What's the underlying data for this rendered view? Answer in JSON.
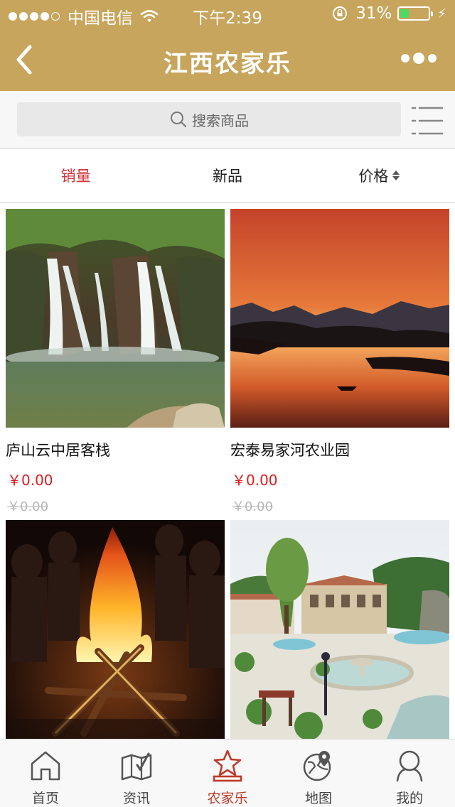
{
  "status_bar": {
    "carrier": "中国电信",
    "time": "下午2:39",
    "battery_percent": "31%",
    "battery_level": 0.31,
    "signal_bars_filled": 4,
    "signal_bars_total": 5
  },
  "navbar": {
    "title": "江西农家乐",
    "back_icon": "chevron-left-icon",
    "more_icon": "more-dots-icon"
  },
  "search": {
    "placeholder": "搜索商品",
    "list_icon": "list-icon"
  },
  "sort_tabs": [
    {
      "label": "销量",
      "active": true
    },
    {
      "label": "新品",
      "active": false
    },
    {
      "label": "价格",
      "active": false,
      "icon": "sort-arrows-icon"
    }
  ],
  "products": [
    {
      "name": "庐山云中居客栈",
      "price": "￥0.00",
      "original_price": "￥0.00",
      "image": "waterfall"
    },
    {
      "name": "宏泰易家河农业园",
      "price": "￥0.00",
      "original_price": "￥0.00",
      "image": "sunset-lake"
    },
    {
      "name": "",
      "price": "",
      "original_price": "",
      "image": "bonfire"
    },
    {
      "name": "",
      "price": "",
      "original_price": "",
      "image": "villa-garden"
    }
  ],
  "tabbar": [
    {
      "label": "首页",
      "icon": "home-icon",
      "active": false
    },
    {
      "label": "资讯",
      "icon": "news-icon",
      "active": false
    },
    {
      "label": "农家乐",
      "icon": "star-icon",
      "active": true
    },
    {
      "label": "地图",
      "icon": "globe-pin-icon",
      "active": false
    },
    {
      "label": "我的",
      "icon": "user-icon",
      "active": false
    }
  ],
  "colors": {
    "brand_gold": "#c7a55c",
    "active_red": "#d0343a",
    "price_red": "#e01c1c"
  }
}
